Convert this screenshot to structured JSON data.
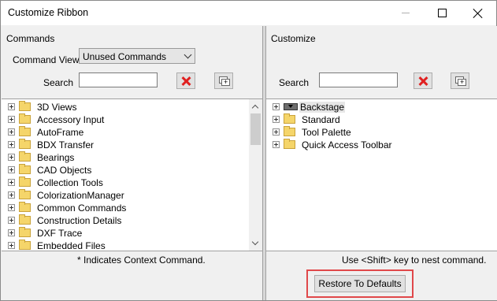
{
  "window": {
    "title": "Customize Ribbon"
  },
  "left": {
    "section_label": "Commands",
    "view_label": "Command View",
    "command_view": "Unused Commands",
    "search_label": "Search",
    "search_value": "",
    "items": [
      {
        "label": "3D Views"
      },
      {
        "label": "Accessory Input"
      },
      {
        "label": "AutoFrame"
      },
      {
        "label": "BDX Transfer"
      },
      {
        "label": "Bearings"
      },
      {
        "label": "CAD Objects"
      },
      {
        "label": "Collection Tools"
      },
      {
        "label": "ColorizationManager"
      },
      {
        "label": "Common Commands"
      },
      {
        "label": "Construction Details"
      },
      {
        "label": "DXF Trace"
      },
      {
        "label": "Embedded Files"
      }
    ],
    "footnote": "* Indicates Context Command."
  },
  "right": {
    "section_label": "Customize",
    "search_label": "Search",
    "search_value": "",
    "items": [
      {
        "label": "Backstage"
      },
      {
        "label": "Standard"
      },
      {
        "label": "Tool Palette"
      },
      {
        "label": "Quick Access Toolbar"
      }
    ],
    "footnote": "Use <Shift> key to nest command.",
    "restore_label": "Restore To Defaults"
  }
}
